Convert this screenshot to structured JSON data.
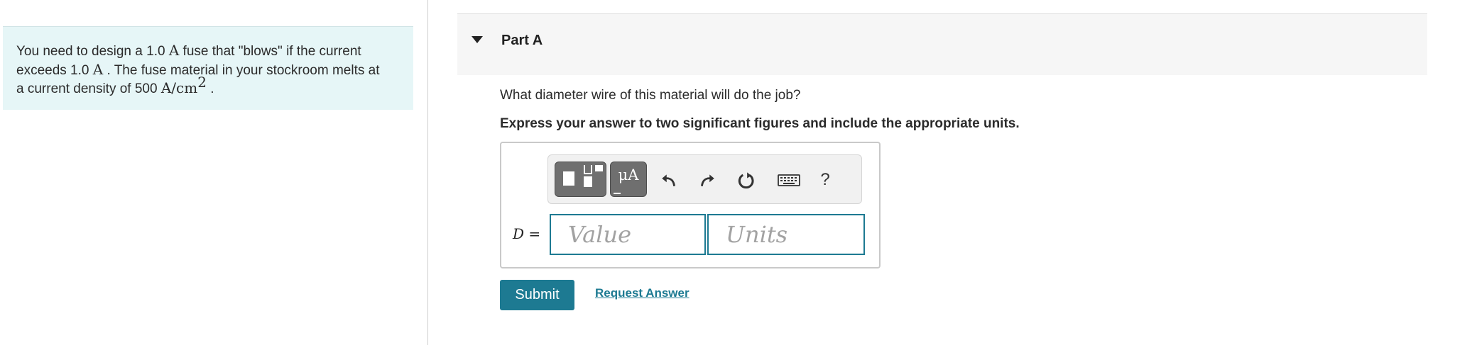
{
  "problem": {
    "text_1": "You need to design a 1.0 ",
    "unit_A_1": "A",
    "text_2": " fuse that \"blows\" if the current",
    "text_3": "exceeds 1.0 ",
    "unit_A_2": "A",
    "text_4": " . The fuse material in your stockroom melts at",
    "text_5": "a current density of 500 ",
    "unit_density": "A/cm",
    "unit_density_exp": "2",
    "text_6": " ."
  },
  "part": {
    "title": "Part A",
    "question": "What diameter wire of this material will do the job?",
    "instruction": "Express your answer to two significant figures and include the appropriate units."
  },
  "toolbar": {
    "templates_icon": "templates-icon",
    "symbols_label": "μA",
    "undo_icon": "undo-icon",
    "redo_icon": "redo-icon",
    "reset_icon": "reset-icon",
    "keyboard_icon": "keyboard-icon",
    "help_label": "?"
  },
  "answer": {
    "variable": "D",
    "equals": " =",
    "value": "",
    "value_placeholder": "Value",
    "units": "",
    "units_placeholder": "Units"
  },
  "actions": {
    "submit_label": "Submit",
    "request_answer_label": "Request Answer"
  },
  "colors": {
    "accent": "#1d7a92",
    "problem_bg": "#e6f6f7",
    "header_bg": "#f6f6f6"
  }
}
